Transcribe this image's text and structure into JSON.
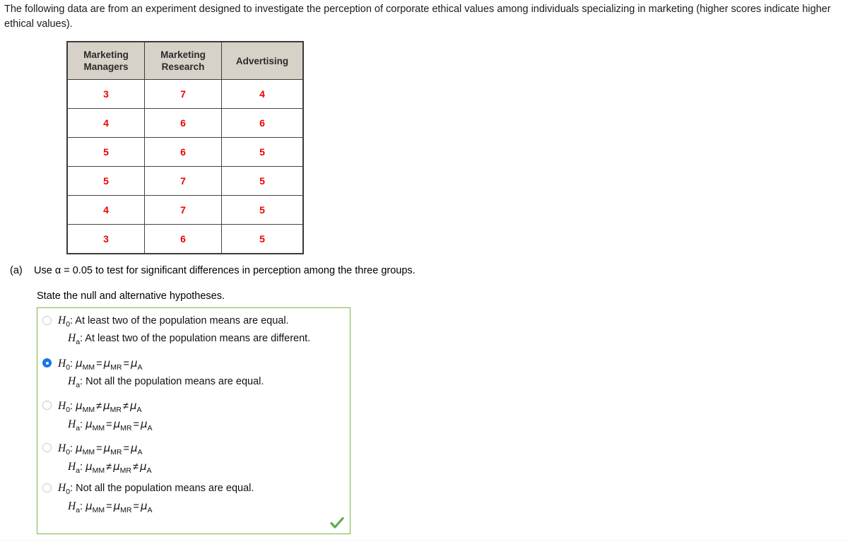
{
  "intro": {
    "text": "The following data are from an experiment designed to investigate the perception of corporate ethical values among individuals specializing in marketing (higher scores indicate higher ethical values)."
  },
  "table": {
    "headers": [
      "Marketing Managers",
      "Marketing Research",
      "Advertising"
    ],
    "header_lines": [
      [
        "Marketing",
        "Managers"
      ],
      [
        "Marketing",
        "Research"
      ],
      [
        "Advertising",
        ""
      ]
    ],
    "rows": [
      [
        "3",
        "7",
        "4"
      ],
      [
        "4",
        "6",
        "6"
      ],
      [
        "5",
        "6",
        "5"
      ],
      [
        "5",
        "7",
        "5"
      ],
      [
        "4",
        "7",
        "5"
      ],
      [
        "3",
        "6",
        "5"
      ]
    ],
    "value_color": "#ee0000",
    "header_bg": "#d6d2c7"
  },
  "part_a": {
    "label": "(a)",
    "prompt": "Use α = 0.05 to test for significant differences in perception among the three groups.",
    "instruction": "State the null and alternative hypotheses."
  },
  "answer_box": {
    "border_color": "#7ab648",
    "selected_index": 1,
    "options": [
      {
        "null_prefix": "H",
        "null_sub": "0",
        "null_text": ": At least two of the population means are equal.",
        "alt_prefix": "H",
        "alt_sub": "a",
        "alt_text": ": At least two of the population means are different.",
        "selected": false
      },
      {
        "null_prefix": "H",
        "null_sub": "0",
        "null_text": ": μMM = μMR = μA",
        "alt_prefix": "H",
        "alt_sub": "a",
        "alt_text": ": Not all the population means are equal.",
        "selected": true
      },
      {
        "null_prefix": "H",
        "null_sub": "0",
        "null_text": ": μMM ≠ μMR ≠ μA",
        "alt_prefix": "H",
        "alt_sub": "a",
        "alt_text": ": μMM = μMR = μA",
        "selected": false
      },
      {
        "null_prefix": "H",
        "null_sub": "0",
        "null_text": ": μMM = μMR = μA",
        "alt_prefix": "H",
        "alt_sub": "a",
        "alt_text": ": μMM ≠ μMR ≠ μA",
        "selected": false
      },
      {
        "null_prefix": "H",
        "null_sub": "0",
        "null_text": ": Not all the population means are equal.",
        "alt_prefix": "H",
        "alt_sub": "a",
        "alt_text": ": μMM = μMR = μA",
        "selected": false
      }
    ],
    "status_icon": "check-icon",
    "status_color": "#63a84c"
  },
  "glyphs": {
    "mu": "μ",
    "eq": "=",
    "neq": "≠",
    "sub_mm": "MM",
    "sub_mr": "MR",
    "sub_a": "A",
    "sub_0": "0",
    "sub_alt": "a",
    "colon": ":"
  }
}
